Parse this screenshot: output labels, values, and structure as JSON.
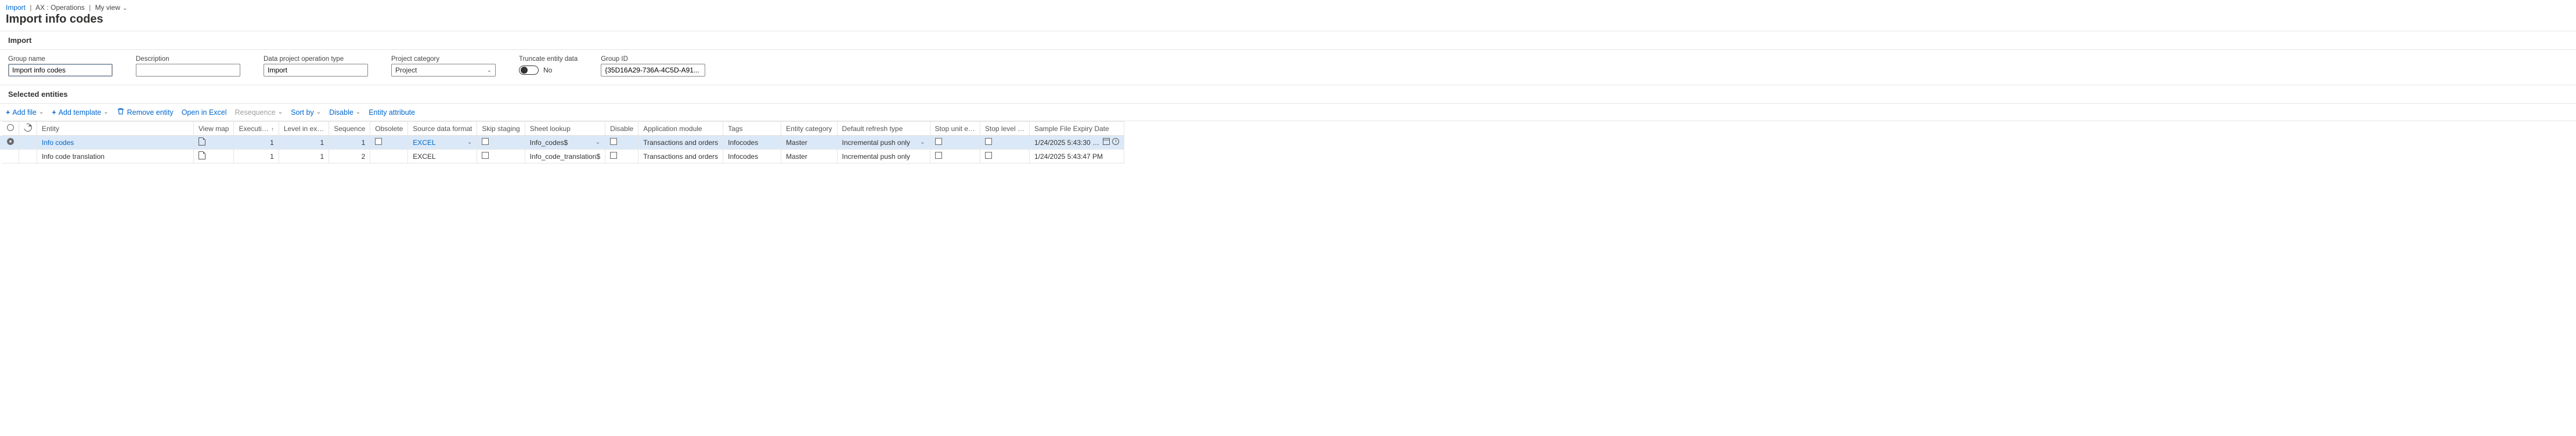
{
  "breadcrumb": {
    "item1": "Import",
    "item2": "AX : Operations",
    "item3": "My view"
  },
  "page_title": "Import info codes",
  "sections": {
    "import": "Import",
    "selected_entities": "Selected entities"
  },
  "form": {
    "group_name": {
      "label": "Group name",
      "value": "Import info codes"
    },
    "description": {
      "label": "Description",
      "value": ""
    },
    "operation_type": {
      "label": "Data project operation type",
      "value": "Import"
    },
    "project_category": {
      "label": "Project category",
      "value": "Project"
    },
    "truncate": {
      "label": "Truncate entity data",
      "value": "No"
    },
    "group_id": {
      "label": "Group ID",
      "value": "{35D16A29-736A-4C5D-A91..."
    }
  },
  "toolbar": {
    "add_file": "Add file",
    "add_template": "Add template",
    "remove_entity": "Remove entity",
    "open_excel": "Open in Excel",
    "resequence": "Resequence",
    "sort_by": "Sort by",
    "disable": "Disable",
    "entity_attribute": "Entity attribute"
  },
  "grid": {
    "headers": {
      "entity": "Entity",
      "view_map": "View map",
      "execution_unit": "Executi…",
      "level_in_execution": "Level in ex…",
      "sequence": "Sequence",
      "obsolete": "Obsolete",
      "source_data_format": "Source data format",
      "skip_staging": "Skip staging",
      "sheet_lookup": "Sheet lookup",
      "disable": "Disable",
      "application_module": "Application module",
      "tags": "Tags",
      "entity_category": "Entity category",
      "default_refresh_type": "Default refresh type",
      "stop_unit_error": "Stop unit e…",
      "stop_level_error": "Stop level …",
      "sample_expiry": "Sample File Expiry Date"
    },
    "rows": [
      {
        "selected": true,
        "entity": "Info codes",
        "execution_unit": "1",
        "level": "1",
        "sequence": "1",
        "obsolete": false,
        "source_data_format": "EXCEL",
        "skip_staging": false,
        "sheet_lookup": "Info_codes$",
        "disable": false,
        "application_module": "Transactions and orders",
        "tags": "Infocodes",
        "entity_category": "Master",
        "default_refresh_type": "Incremental push only",
        "stop_unit_error": false,
        "stop_level_error": false,
        "sample_expiry": "1/24/2025 5:43:30 …"
      },
      {
        "selected": false,
        "entity": "Info code translation",
        "execution_unit": "1",
        "level": "1",
        "sequence": "2",
        "obsolete": false,
        "source_data_format": "EXCEL",
        "skip_staging": false,
        "sheet_lookup": "Info_code_translation$",
        "disable": false,
        "application_module": "Transactions and orders",
        "tags": "Infocodes",
        "entity_category": "Master",
        "default_refresh_type": "Incremental push only",
        "stop_unit_error": false,
        "stop_level_error": false,
        "sample_expiry": "1/24/2025 5:43:47 PM"
      }
    ]
  }
}
